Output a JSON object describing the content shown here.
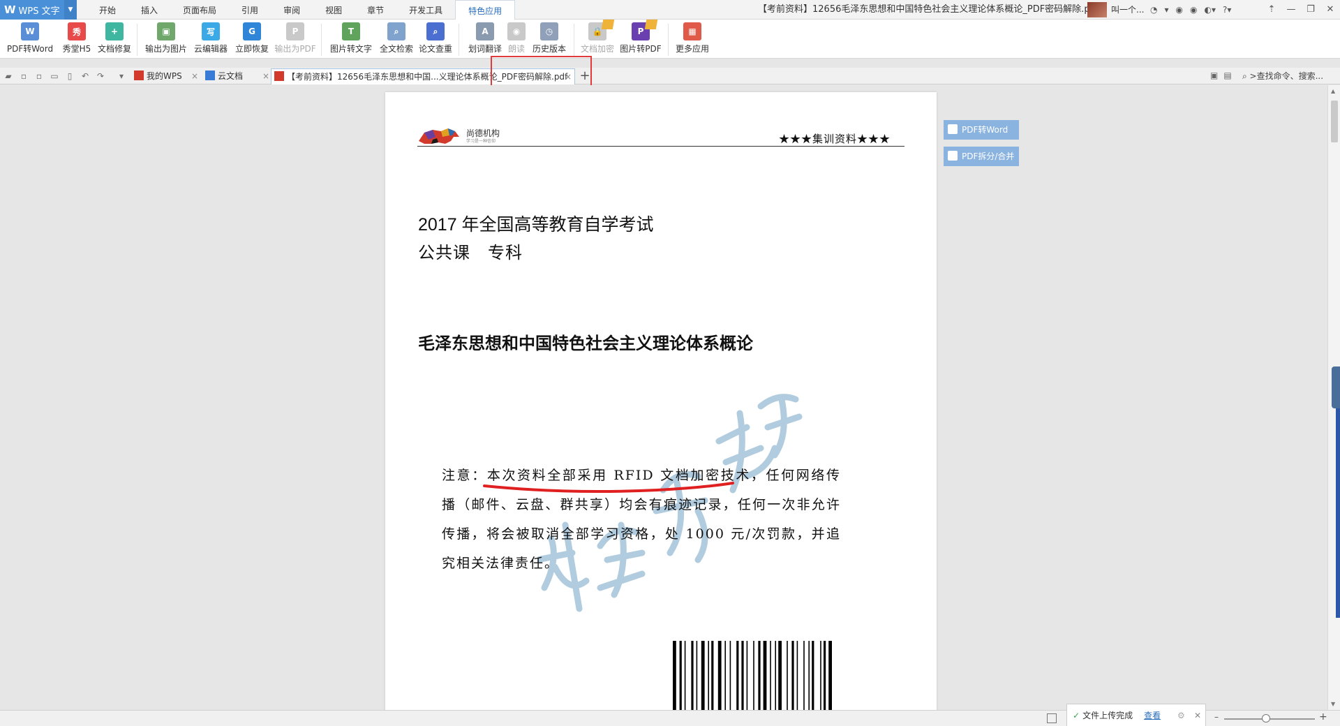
{
  "app": {
    "name": "WPS 文字",
    "logo_letter": "W"
  },
  "menus": [
    "开始",
    "插入",
    "页面布局",
    "引用",
    "审阅",
    "视图",
    "章节",
    "开发工具",
    "特色应用"
  ],
  "active_menu_index": 8,
  "window_title": "【考前资料】12656毛泽东思想和中国特色社会主义理论体系概论_PDF密码解除.pdf",
  "user": {
    "name": "叫一个..."
  },
  "ribbon": [
    {
      "label": "PDF转Word",
      "icon": "pdf-to-word-icon",
      "color": "#5a8fd8",
      "glyph": "W",
      "disabled": false
    },
    {
      "label": "秀堂H5",
      "icon": "xiutang-h5-icon",
      "color": "#e84a4a",
      "glyph": "秀",
      "disabled": false
    },
    {
      "label": "文档修复",
      "icon": "doc-repair-icon",
      "color": "#3fb6a0",
      "glyph": "+",
      "disabled": false
    },
    {
      "label": "输出为图片",
      "icon": "export-image-icon",
      "color": "#6fa86a",
      "glyph": "▣",
      "disabled": false
    },
    {
      "label": "云编辑器",
      "icon": "cloud-editor-icon",
      "color": "#3ba9e6",
      "glyph": "写",
      "disabled": false
    },
    {
      "label": "立即恢复",
      "icon": "instant-restore-icon",
      "color": "#2f86d8",
      "glyph": "G",
      "disabled": false
    },
    {
      "label": "输出为PDF",
      "icon": "export-pdf-icon",
      "color": "#c9c9c9",
      "glyph": "P",
      "disabled": true
    },
    {
      "label": "图片转文字",
      "icon": "image-to-text-icon",
      "color": "#5fa35c",
      "glyph": "T",
      "disabled": false
    },
    {
      "label": "全文检索",
      "icon": "fulltext-search-icon",
      "color": "#7fa3cc",
      "glyph": "⌕",
      "disabled": false
    },
    {
      "label": "论文查重",
      "icon": "plagiarism-check-icon",
      "color": "#4a6fd0",
      "glyph": "⌕",
      "disabled": false
    },
    {
      "label": "划词翻译",
      "icon": "translate-icon",
      "color": "#8a9bb0",
      "glyph": "A",
      "disabled": false
    },
    {
      "label": "朗读",
      "icon": "read-aloud-icon",
      "color": "#c9c9c9",
      "glyph": "◉",
      "disabled": true
    },
    {
      "label": "历史版本",
      "icon": "history-version-icon",
      "color": "#8fa0b8",
      "glyph": "◷",
      "disabled": false
    },
    {
      "label": "文档加密",
      "icon": "doc-encrypt-icon",
      "color": "#c9c9c9",
      "glyph": "🔒",
      "disabled": true
    },
    {
      "label": "图片转PDF",
      "icon": "image-to-pdf-icon",
      "color": "#6a3fb0",
      "glyph": "P",
      "disabled": false
    },
    {
      "label": "更多应用",
      "icon": "more-apps-icon",
      "color": "#e05a4a",
      "glyph": "▦",
      "disabled": false
    }
  ],
  "tabs": [
    {
      "label": "我的WPS",
      "icon": "wps-icon"
    },
    {
      "label": "云文档",
      "icon": "cloud-doc-icon"
    },
    {
      "label": "【考前资料】12656毛泽东思想和中国...义理论体系概论_PDF密码解除.pdf",
      "icon": "pdf-file-icon"
    }
  ],
  "active_tab_index": 2,
  "search_command": ">查找命令、搜索...",
  "document": {
    "org_name": "尚德机构",
    "org_slogan": "学习是一种信仰",
    "header_right": "★★★集训资料★★★",
    "line1": "2017 年全国高等教育自学考试",
    "line2": "公共课　专科",
    "title": "毛泽东思想和中国特色社会主义理论体系概论",
    "notice": "注意：本次资料全部采用 RFID 文档加密技术，任何网络传播（邮件、云盘、群共享）均会有痕迹记录，任何一次非允许传播，将会被取消全部学习资格，处 1000 元/次罚款，并追究相关法律责任。"
  },
  "side_buttons": [
    {
      "label": "PDF转Word"
    },
    {
      "label": "PDF拆分/合并"
    }
  ],
  "status": {
    "upload_text": "文件上传完成",
    "upload_link": "查看"
  },
  "colors": {
    "app_blue": "#4a90d9",
    "highlight_red": "#e03a3a",
    "side_button": "#8bb3e0",
    "watermark": "#a9c7dc"
  }
}
